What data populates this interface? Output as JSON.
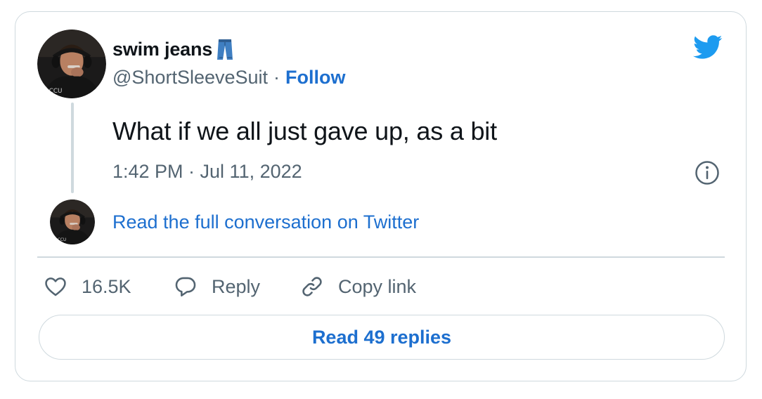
{
  "author": {
    "display_name": "swim jeans",
    "name_emoji": "jeans-icon",
    "handle": "@ShortSleeveSuit",
    "separator": "·",
    "follow_label": "Follow"
  },
  "brand_icon": "twitter-bird-icon",
  "tweet": {
    "text": "What if we all just gave up, as a bit",
    "timestamp": "1:42 PM · Jul 11, 2022"
  },
  "conversation_link": "Read the full conversation on Twitter",
  "actions": {
    "likes_count": "16.5K",
    "reply_label": "Reply",
    "copy_link_label": "Copy link"
  },
  "read_replies_label": "Read 49 replies",
  "colors": {
    "link_blue": "#1d6fcf",
    "brand_blue": "#1d9bf0",
    "text_primary": "#0f1419",
    "text_secondary": "#536471",
    "border": "#cfd9de"
  }
}
